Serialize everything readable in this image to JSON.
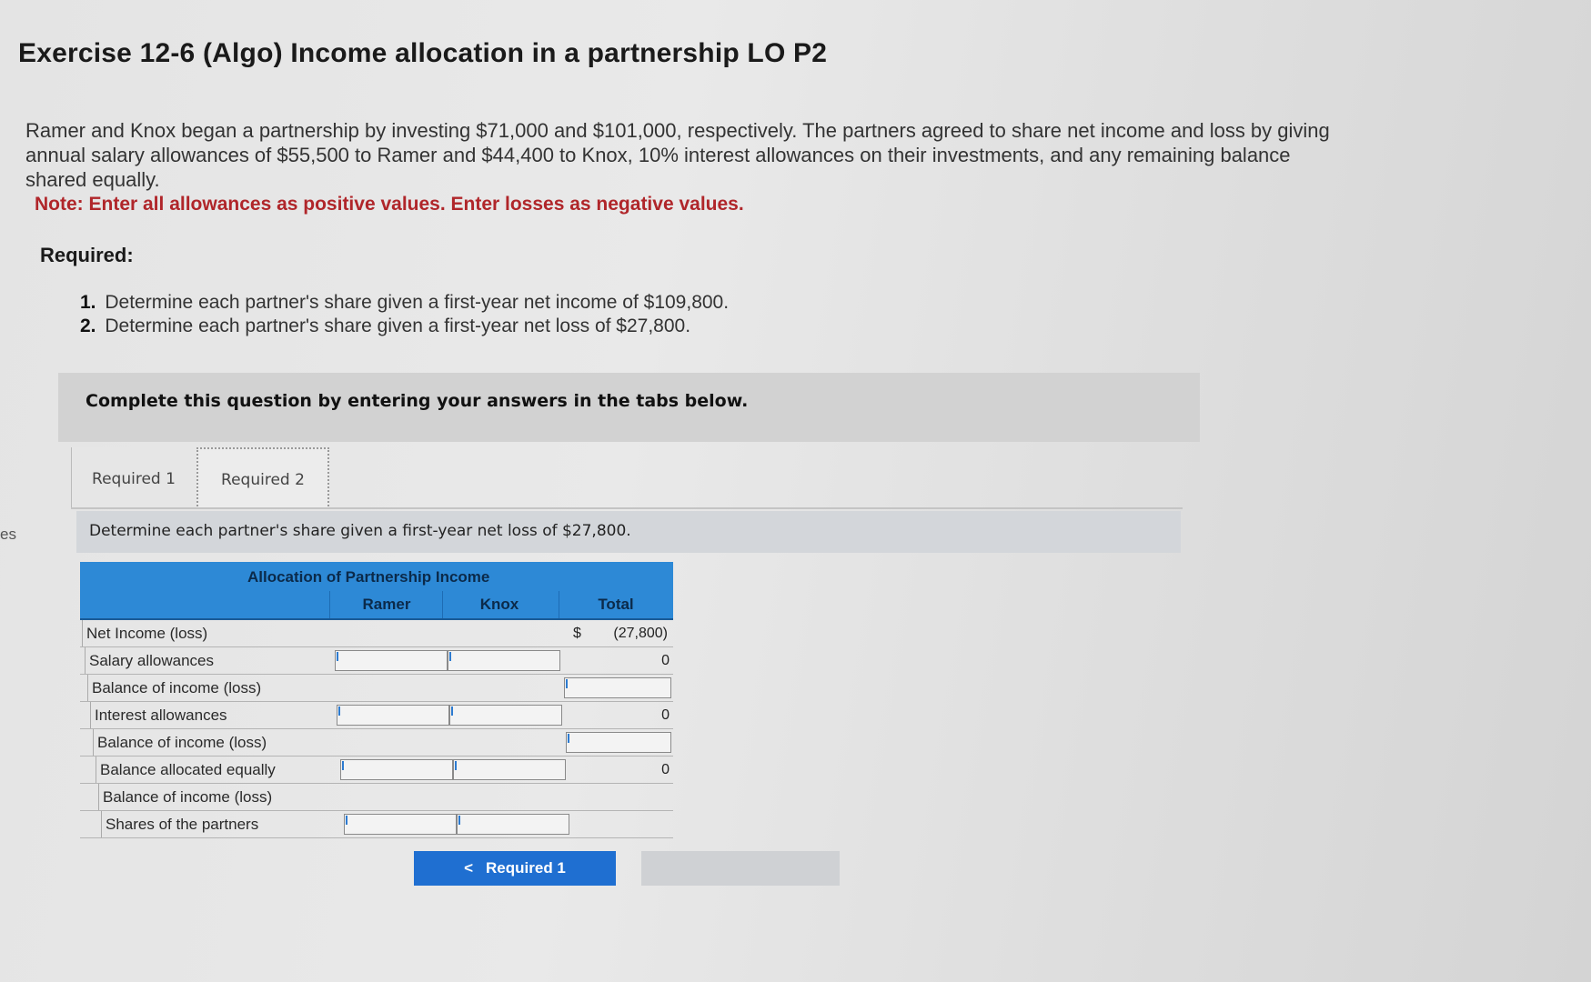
{
  "side_stub": "es",
  "title": "Exercise 12-6 (Algo) Income allocation in a partnership LO P2",
  "intro": "Ramer and Knox began a partnership by investing $71,000 and $101,000, respectively. The partners agreed to share net income and loss by giving annual salary allowances of $55,500 to Ramer and $44,400 to Knox, 10% interest allowances on their investments, and any remaining balance shared equally.",
  "note": "Note: Enter all allowances as positive values. Enter losses as negative values.",
  "required_label": "Required:",
  "requirements": [
    {
      "num": "1.",
      "text": "Determine each partner's share given a first-year net income of $109,800."
    },
    {
      "num": "2.",
      "text": "Determine each partner's share given a first-year net loss of $27,800."
    }
  ],
  "complete_text": "Complete this question by entering your answers in the tabs below.",
  "tabs": [
    {
      "label": "Required 1"
    },
    {
      "label": "Required 2"
    }
  ],
  "prompt": "Determine each partner's share given a first-year net loss of $27,800.",
  "table": {
    "title": "Allocation of Partnership Income",
    "columns": [
      "Ramer",
      "Knox",
      "Total"
    ],
    "rows": [
      {
        "label": "Net Income (loss)",
        "total_prefix": "$",
        "total": "(27,800)"
      },
      {
        "label": "Salary allowances",
        "total": "0"
      },
      {
        "label": "Balance of income (loss)",
        "total": ""
      },
      {
        "label": "Interest allowances",
        "total": "0"
      },
      {
        "label": "Balance of income (loss)",
        "total": ""
      },
      {
        "label": "Balance allocated equally",
        "total": "0"
      },
      {
        "label": "Balance of income (loss)",
        "total": ""
      },
      {
        "label": "Shares of the partners",
        "total": ""
      }
    ]
  },
  "nav": {
    "prev_arrow": "<",
    "prev_label": "Required 1"
  }
}
